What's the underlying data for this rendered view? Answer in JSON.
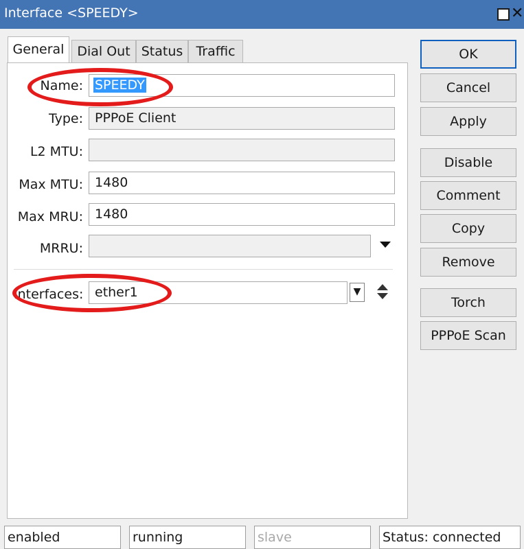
{
  "window": {
    "title": "Interface <SPEEDY>"
  },
  "tabs": [
    {
      "label": "General",
      "active": true
    },
    {
      "label": "Dial Out",
      "active": false
    },
    {
      "label": "Status",
      "active": false
    },
    {
      "label": "Traffic",
      "active": false
    }
  ],
  "fields": {
    "name": {
      "label": "Name:",
      "value": "SPEEDY",
      "selected": true
    },
    "type": {
      "label": "Type:",
      "value": "PPPoE Client"
    },
    "l2mtu": {
      "label": "L2 MTU:",
      "value": ""
    },
    "max_mtu": {
      "label": "Max MTU:",
      "value": "1480"
    },
    "max_mru": {
      "label": "Max MRU:",
      "value": "1480"
    },
    "mrru": {
      "label": "MRRU:",
      "value": ""
    },
    "interfaces": {
      "label": "Interfaces:",
      "value": "ether1"
    }
  },
  "buttons": {
    "ok": "OK",
    "cancel": "Cancel",
    "apply": "Apply",
    "disable": "Disable",
    "comment": "Comment",
    "copy": "Copy",
    "remove": "Remove",
    "torch": "Torch",
    "pppoe_scan": "PPPoE Scan"
  },
  "statusbar": {
    "enabled": "enabled",
    "running": "running",
    "slave": "slave",
    "status": "Status: connected"
  },
  "colors": {
    "titlebar": "#4374b4",
    "selection": "#3399ff",
    "annotation": "#e31b1b"
  },
  "icons": {
    "maximize": "maximize-icon",
    "close": "close-icon",
    "mrru_dropdown": "dropdown-arrow-icon",
    "interfaces_dropdown": "dropdown-button-icon",
    "interfaces_updown": "up-down-arrows-icon"
  }
}
